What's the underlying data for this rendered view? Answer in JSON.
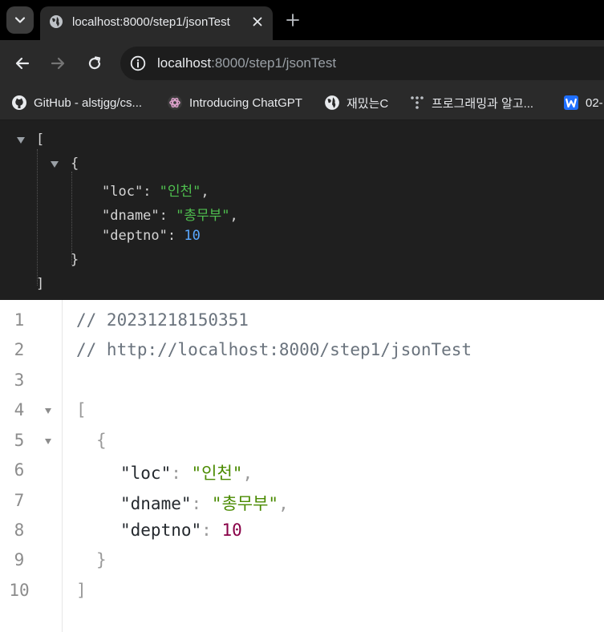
{
  "browser": {
    "tab": {
      "title": "localhost:8000/step1/jsonTest"
    },
    "address_bar": {
      "host": "localhost",
      "rest": ":8000/step1/jsonTest"
    },
    "bookmarks": [
      {
        "label": "GitHub - alstjgg/cs...",
        "icon": "github-icon"
      },
      {
        "label": "Introducing ChatGPT",
        "icon": "chatgpt-icon"
      },
      {
        "label": "재밌는C",
        "icon": "globe-icon"
      },
      {
        "label": "프로그래밍과 알고...",
        "icon": "tree-icon"
      },
      {
        "label": "02-",
        "icon": "w-icon"
      }
    ]
  },
  "dark_viewer": {
    "open_bracket": "[",
    "open_brace": "{",
    "close_brace": "}",
    "close_bracket": "]",
    "rows": [
      {
        "key": "\"loc\"",
        "sep": ": ",
        "value": "\"인천\"",
        "type": "string",
        "trail": ","
      },
      {
        "key": "\"dname\"",
        "sep": ": ",
        "value": "\"총무부\"",
        "type": "string",
        "trail": ","
      },
      {
        "key": "\"deptno\"",
        "sep": ": ",
        "value": "10",
        "type": "number",
        "trail": ""
      }
    ]
  },
  "code_view": {
    "line_numbers": [
      "1",
      "2",
      "3",
      "4",
      "5",
      "6",
      "7",
      "8",
      "9",
      "10"
    ],
    "comment_timestamp": "// 20231218150351",
    "comment_url": "// http://localhost:8000/step1/jsonTest",
    "open_bracket": "[",
    "open_brace": "{",
    "close_brace": "}",
    "close_bracket": "]",
    "rows": [
      {
        "key": "\"loc\"",
        "sep": ": ",
        "value": "\"인천\"",
        "trail": ","
      },
      {
        "key": "\"dname\"",
        "sep": ": ",
        "value": "\"총무부\"",
        "trail": ","
      },
      {
        "key": "\"deptno\"",
        "sep": ": ",
        "value": "10",
        "trail": ""
      }
    ]
  },
  "colors": {
    "dark_string": "#4fbf4f",
    "dark_number": "#5aa8ff",
    "light_string": "#4a8a00",
    "light_number": "#880047"
  }
}
